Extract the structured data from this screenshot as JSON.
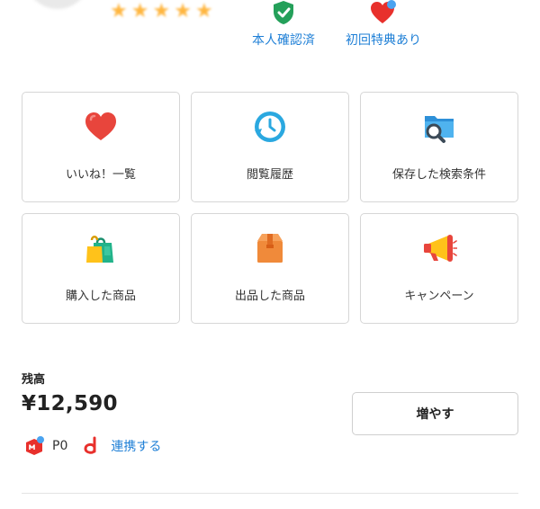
{
  "profile": {
    "stars": [
      "★",
      "★",
      "★",
      "★",
      "★"
    ],
    "badges": [
      {
        "label": "本人確認済",
        "icon": "shield-check-icon",
        "color": "#24a05a"
      },
      {
        "label": "初回特典あり",
        "icon": "heart-icon",
        "color": "#e8302c"
      }
    ]
  },
  "tiles": [
    {
      "label": "いいね！一覧",
      "icon": "heart-icon"
    },
    {
      "label": "閲覧履歴",
      "icon": "clock-history-icon"
    },
    {
      "label": "保存した検索条件",
      "icon": "folder-search-icon"
    },
    {
      "label": "購入した商品",
      "icon": "shopping-bag-icon"
    },
    {
      "label": "出品した商品",
      "icon": "box-icon"
    },
    {
      "label": "キャンペーン",
      "icon": "megaphone-icon"
    }
  ],
  "balance": {
    "title": "残高",
    "amount": "¥12,590",
    "increase_label": "増やす",
    "points_value": "P0",
    "link_label": "連携する"
  },
  "colors": {
    "accent_blue": "#1e7fd6",
    "heart_red": "#e8302c",
    "star_gold": "#ffb640",
    "border_gray": "#d6d6d6"
  }
}
